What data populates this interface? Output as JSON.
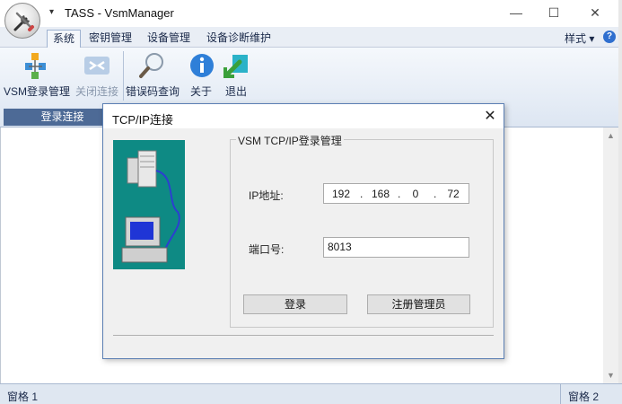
{
  "window": {
    "title": "TASS - VsmManager",
    "minimize": "—",
    "maximize": "☐",
    "close": "✕",
    "quick_access": "▾"
  },
  "menu": {
    "tabs": [
      "系统",
      "密钥管理",
      "设备管理",
      "设备诊断维护"
    ],
    "active_tab": "系统",
    "style_menu": "样式 ▾",
    "help": "?"
  },
  "ribbon": {
    "buttons": [
      {
        "label": "VSM登录管理",
        "icon": "vsm-login-icon",
        "enabled": true
      },
      {
        "label": "关闭连接",
        "icon": "disconnect-icon",
        "enabled": false
      },
      {
        "label": "错误码查询",
        "icon": "magnifier-icon",
        "enabled": true
      },
      {
        "label": "关于",
        "icon": "info-icon",
        "enabled": true
      },
      {
        "label": "退出",
        "icon": "exit-icon",
        "enabled": true
      }
    ],
    "group_label": "登录连接"
  },
  "status": {
    "pane1": "窗格 1",
    "pane2": "窗格 2"
  },
  "dialog": {
    "title": "TCP/IP连接",
    "close": "✕",
    "group_title": "VSM TCP/IP登录管理",
    "ip_label": "IP地址:",
    "ip_octets": [
      "192",
      "168",
      "0",
      "72"
    ],
    "port_label": "端口号:",
    "port_value": "8013",
    "login_button": "登录",
    "register_button": "注册管理员"
  },
  "colors": {
    "accent": "#4d6a96",
    "dialog_image_bg": "#0e8a84"
  }
}
